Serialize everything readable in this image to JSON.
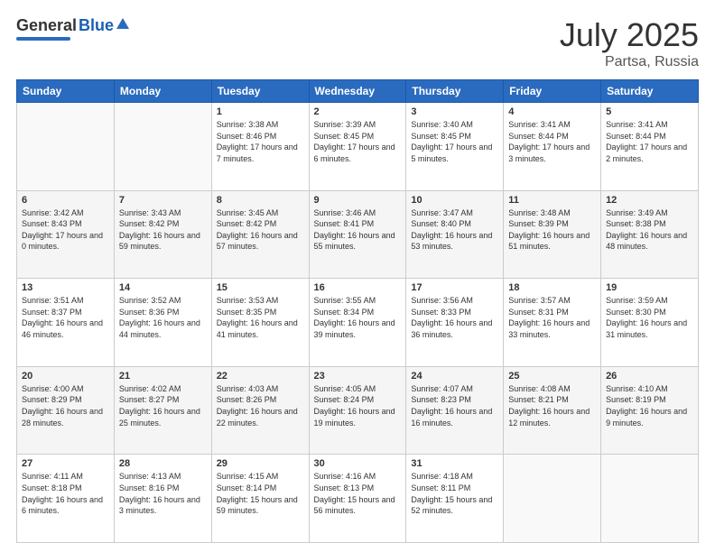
{
  "header": {
    "logo_general": "General",
    "logo_blue": "Blue",
    "title": "July 2025",
    "location": "Partsa, Russia"
  },
  "days_of_week": [
    "Sunday",
    "Monday",
    "Tuesday",
    "Wednesday",
    "Thursday",
    "Friday",
    "Saturday"
  ],
  "weeks": [
    [
      {
        "day": "",
        "sunrise": "",
        "sunset": "",
        "daylight": ""
      },
      {
        "day": "",
        "sunrise": "",
        "sunset": "",
        "daylight": ""
      },
      {
        "day": "1",
        "sunrise": "Sunrise: 3:38 AM",
        "sunset": "Sunset: 8:46 PM",
        "daylight": "Daylight: 17 hours and 7 minutes."
      },
      {
        "day": "2",
        "sunrise": "Sunrise: 3:39 AM",
        "sunset": "Sunset: 8:45 PM",
        "daylight": "Daylight: 17 hours and 6 minutes."
      },
      {
        "day": "3",
        "sunrise": "Sunrise: 3:40 AM",
        "sunset": "Sunset: 8:45 PM",
        "daylight": "Daylight: 17 hours and 5 minutes."
      },
      {
        "day": "4",
        "sunrise": "Sunrise: 3:41 AM",
        "sunset": "Sunset: 8:44 PM",
        "daylight": "Daylight: 17 hours and 3 minutes."
      },
      {
        "day": "5",
        "sunrise": "Sunrise: 3:41 AM",
        "sunset": "Sunset: 8:44 PM",
        "daylight": "Daylight: 17 hours and 2 minutes."
      }
    ],
    [
      {
        "day": "6",
        "sunrise": "Sunrise: 3:42 AM",
        "sunset": "Sunset: 8:43 PM",
        "daylight": "Daylight: 17 hours and 0 minutes."
      },
      {
        "day": "7",
        "sunrise": "Sunrise: 3:43 AM",
        "sunset": "Sunset: 8:42 PM",
        "daylight": "Daylight: 16 hours and 59 minutes."
      },
      {
        "day": "8",
        "sunrise": "Sunrise: 3:45 AM",
        "sunset": "Sunset: 8:42 PM",
        "daylight": "Daylight: 16 hours and 57 minutes."
      },
      {
        "day": "9",
        "sunrise": "Sunrise: 3:46 AM",
        "sunset": "Sunset: 8:41 PM",
        "daylight": "Daylight: 16 hours and 55 minutes."
      },
      {
        "day": "10",
        "sunrise": "Sunrise: 3:47 AM",
        "sunset": "Sunset: 8:40 PM",
        "daylight": "Daylight: 16 hours and 53 minutes."
      },
      {
        "day": "11",
        "sunrise": "Sunrise: 3:48 AM",
        "sunset": "Sunset: 8:39 PM",
        "daylight": "Daylight: 16 hours and 51 minutes."
      },
      {
        "day": "12",
        "sunrise": "Sunrise: 3:49 AM",
        "sunset": "Sunset: 8:38 PM",
        "daylight": "Daylight: 16 hours and 48 minutes."
      }
    ],
    [
      {
        "day": "13",
        "sunrise": "Sunrise: 3:51 AM",
        "sunset": "Sunset: 8:37 PM",
        "daylight": "Daylight: 16 hours and 46 minutes."
      },
      {
        "day": "14",
        "sunrise": "Sunrise: 3:52 AM",
        "sunset": "Sunset: 8:36 PM",
        "daylight": "Daylight: 16 hours and 44 minutes."
      },
      {
        "day": "15",
        "sunrise": "Sunrise: 3:53 AM",
        "sunset": "Sunset: 8:35 PM",
        "daylight": "Daylight: 16 hours and 41 minutes."
      },
      {
        "day": "16",
        "sunrise": "Sunrise: 3:55 AM",
        "sunset": "Sunset: 8:34 PM",
        "daylight": "Daylight: 16 hours and 39 minutes."
      },
      {
        "day": "17",
        "sunrise": "Sunrise: 3:56 AM",
        "sunset": "Sunset: 8:33 PM",
        "daylight": "Daylight: 16 hours and 36 minutes."
      },
      {
        "day": "18",
        "sunrise": "Sunrise: 3:57 AM",
        "sunset": "Sunset: 8:31 PM",
        "daylight": "Daylight: 16 hours and 33 minutes."
      },
      {
        "day": "19",
        "sunrise": "Sunrise: 3:59 AM",
        "sunset": "Sunset: 8:30 PM",
        "daylight": "Daylight: 16 hours and 31 minutes."
      }
    ],
    [
      {
        "day": "20",
        "sunrise": "Sunrise: 4:00 AM",
        "sunset": "Sunset: 8:29 PM",
        "daylight": "Daylight: 16 hours and 28 minutes."
      },
      {
        "day": "21",
        "sunrise": "Sunrise: 4:02 AM",
        "sunset": "Sunset: 8:27 PM",
        "daylight": "Daylight: 16 hours and 25 minutes."
      },
      {
        "day": "22",
        "sunrise": "Sunrise: 4:03 AM",
        "sunset": "Sunset: 8:26 PM",
        "daylight": "Daylight: 16 hours and 22 minutes."
      },
      {
        "day": "23",
        "sunrise": "Sunrise: 4:05 AM",
        "sunset": "Sunset: 8:24 PM",
        "daylight": "Daylight: 16 hours and 19 minutes."
      },
      {
        "day": "24",
        "sunrise": "Sunrise: 4:07 AM",
        "sunset": "Sunset: 8:23 PM",
        "daylight": "Daylight: 16 hours and 16 minutes."
      },
      {
        "day": "25",
        "sunrise": "Sunrise: 4:08 AM",
        "sunset": "Sunset: 8:21 PM",
        "daylight": "Daylight: 16 hours and 12 minutes."
      },
      {
        "day": "26",
        "sunrise": "Sunrise: 4:10 AM",
        "sunset": "Sunset: 8:19 PM",
        "daylight": "Daylight: 16 hours and 9 minutes."
      }
    ],
    [
      {
        "day": "27",
        "sunrise": "Sunrise: 4:11 AM",
        "sunset": "Sunset: 8:18 PM",
        "daylight": "Daylight: 16 hours and 6 minutes."
      },
      {
        "day": "28",
        "sunrise": "Sunrise: 4:13 AM",
        "sunset": "Sunset: 8:16 PM",
        "daylight": "Daylight: 16 hours and 3 minutes."
      },
      {
        "day": "29",
        "sunrise": "Sunrise: 4:15 AM",
        "sunset": "Sunset: 8:14 PM",
        "daylight": "Daylight: 15 hours and 59 minutes."
      },
      {
        "day": "30",
        "sunrise": "Sunrise: 4:16 AM",
        "sunset": "Sunset: 8:13 PM",
        "daylight": "Daylight: 15 hours and 56 minutes."
      },
      {
        "day": "31",
        "sunrise": "Sunrise: 4:18 AM",
        "sunset": "Sunset: 8:11 PM",
        "daylight": "Daylight: 15 hours and 52 minutes."
      },
      {
        "day": "",
        "sunrise": "",
        "sunset": "",
        "daylight": ""
      },
      {
        "day": "",
        "sunrise": "",
        "sunset": "",
        "daylight": ""
      }
    ]
  ]
}
